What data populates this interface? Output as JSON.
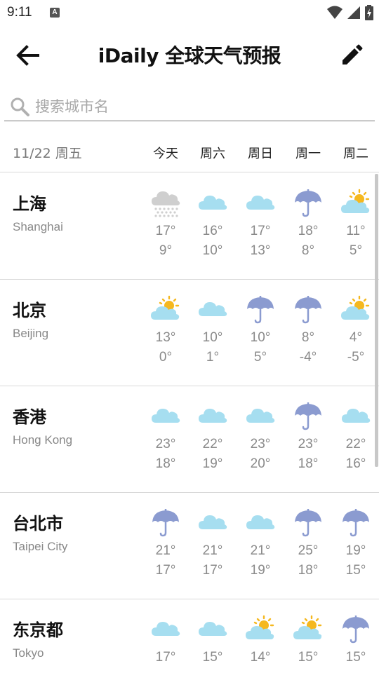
{
  "status_bar": {
    "time": "9:11",
    "notification_glyph": "A",
    "icons": [
      "wifi-icon",
      "signal-icon",
      "battery-icon"
    ]
  },
  "app_bar": {
    "title": "iDaily 全球天气预报",
    "back_icon": "back-arrow-icon",
    "edit_icon": "pencil-icon"
  },
  "search": {
    "placeholder": "搜索城市名",
    "value": ""
  },
  "header": {
    "date": "11/22 周五",
    "days": [
      "今天",
      "周六",
      "周日",
      "周一",
      "周二"
    ]
  },
  "colors": {
    "cloud": "#a6def0",
    "umbrella": "#8b9bd0",
    "sun": "#f5b81f",
    "snow_cloud": "#cfcfcf",
    "divider": "#d8d8d8"
  },
  "cities": [
    {
      "name": "上海",
      "en": "Shanghai",
      "forecast": [
        {
          "icon": "snow-cloud-icon",
          "hi": "17°",
          "lo": "9°"
        },
        {
          "icon": "cloud-icon",
          "hi": "16°",
          "lo": "10°"
        },
        {
          "icon": "cloud-icon",
          "hi": "17°",
          "lo": "13°"
        },
        {
          "icon": "umbrella-icon",
          "hi": "18°",
          "lo": "8°"
        },
        {
          "icon": "sun-cloud-icon",
          "hi": "11°",
          "lo": "5°"
        }
      ]
    },
    {
      "name": "北京",
      "en": "Beijing",
      "forecast": [
        {
          "icon": "sun-cloud-icon",
          "hi": "13°",
          "lo": "0°"
        },
        {
          "icon": "cloud-icon",
          "hi": "10°",
          "lo": "1°"
        },
        {
          "icon": "umbrella-icon",
          "hi": "10°",
          "lo": "5°"
        },
        {
          "icon": "umbrella-icon",
          "hi": "8°",
          "lo": "-4°"
        },
        {
          "icon": "sun-cloud-icon",
          "hi": "4°",
          "lo": "-5°"
        }
      ]
    },
    {
      "name": "香港",
      "en": "Hong Kong",
      "forecast": [
        {
          "icon": "cloud-icon",
          "hi": "23°",
          "lo": "18°"
        },
        {
          "icon": "cloud-icon",
          "hi": "22°",
          "lo": "19°"
        },
        {
          "icon": "cloud-icon",
          "hi": "23°",
          "lo": "20°"
        },
        {
          "icon": "umbrella-icon",
          "hi": "23°",
          "lo": "18°"
        },
        {
          "icon": "cloud-icon",
          "hi": "22°",
          "lo": "16°"
        }
      ]
    },
    {
      "name": "台北市",
      "en": "Taipei City",
      "forecast": [
        {
          "icon": "umbrella-icon",
          "hi": "21°",
          "lo": "17°"
        },
        {
          "icon": "cloud-icon",
          "hi": "21°",
          "lo": "17°"
        },
        {
          "icon": "cloud-icon",
          "hi": "21°",
          "lo": "19°"
        },
        {
          "icon": "umbrella-icon",
          "hi": "25°",
          "lo": "18°"
        },
        {
          "icon": "umbrella-icon",
          "hi": "19°",
          "lo": "15°"
        }
      ]
    },
    {
      "name": "东京都",
      "en": "Tokyo",
      "forecast": [
        {
          "icon": "cloud-icon",
          "hi": "17°",
          "lo": ""
        },
        {
          "icon": "cloud-icon",
          "hi": "15°",
          "lo": ""
        },
        {
          "icon": "sun-cloud-icon",
          "hi": "14°",
          "lo": ""
        },
        {
          "icon": "sun-cloud-icon",
          "hi": "15°",
          "lo": ""
        },
        {
          "icon": "umbrella-icon",
          "hi": "15°",
          "lo": ""
        }
      ]
    }
  ]
}
